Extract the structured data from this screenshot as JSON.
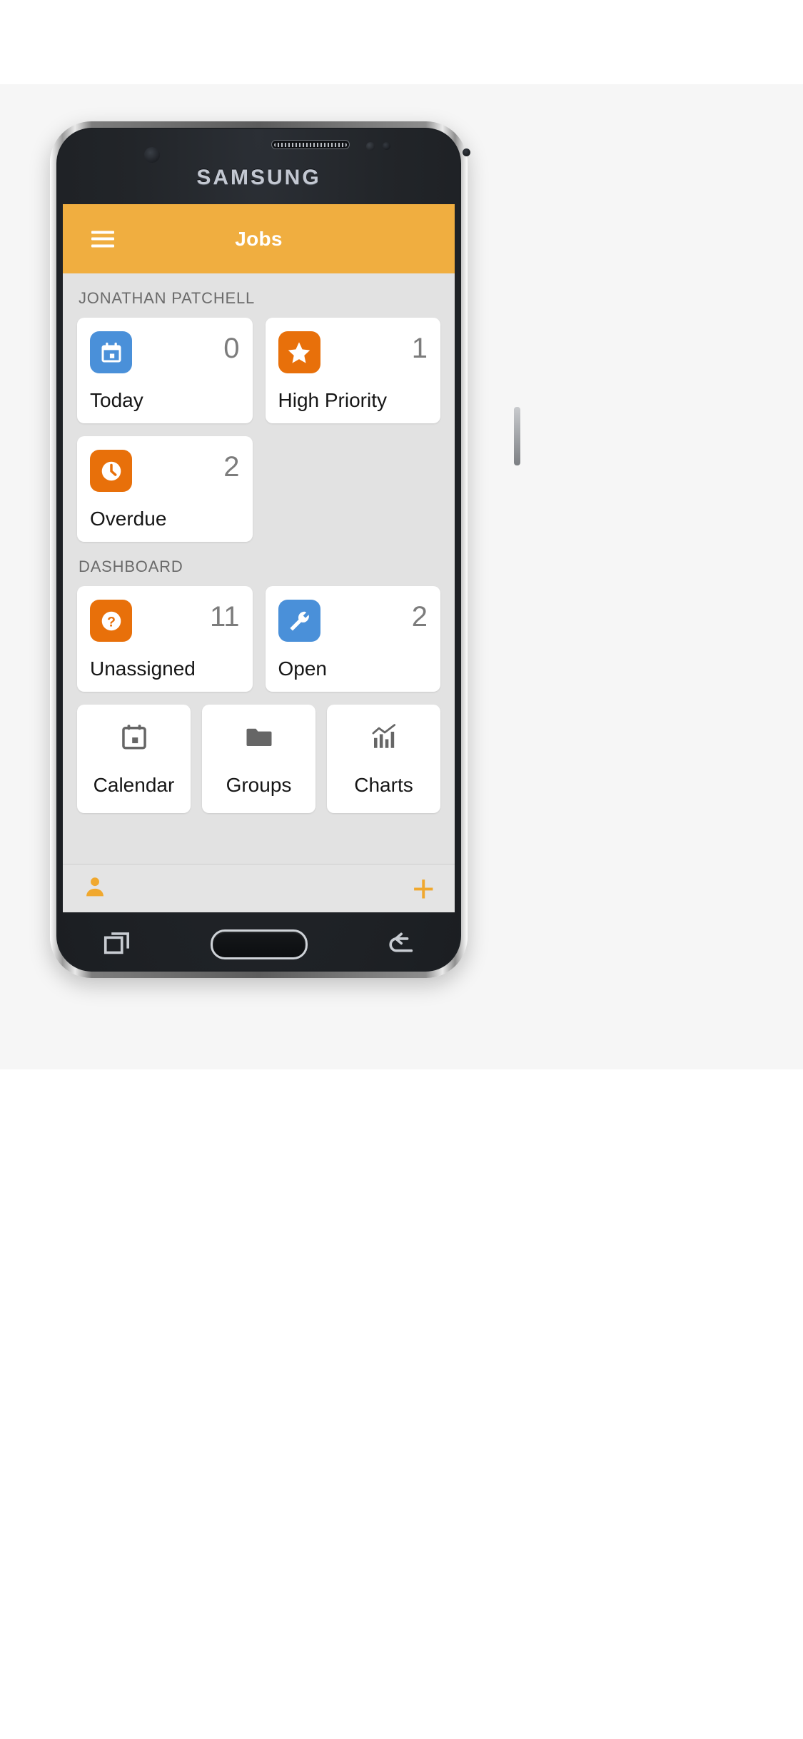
{
  "device": {
    "brand": "SAMSUNG"
  },
  "appbar": {
    "title": "Jobs",
    "menu_icon": "hamburger-menu-icon",
    "background_color": "#f0ae40",
    "title_color": "#ffffff"
  },
  "sections": [
    {
      "title": "JONATHAN PATCHELL",
      "cards": [
        {
          "label": "Today",
          "count": "0",
          "icon": "calendar-icon",
          "icon_color": "#4a90d9"
        },
        {
          "label": "High Priority",
          "count": "1",
          "icon": "star-icon",
          "icon_color": "#e8700a"
        },
        {
          "label": "Overdue",
          "count": "2",
          "icon": "clock-icon",
          "icon_color": "#e8700a"
        }
      ]
    },
    {
      "title": "DASHBOARD",
      "cards": [
        {
          "label": "Unassigned",
          "count": "11",
          "icon": "question-mark-icon",
          "icon_color": "#e8700a"
        },
        {
          "label": "Open",
          "count": "2",
          "icon": "wrench-icon",
          "icon_color": "#4a90d9"
        }
      ],
      "tiles": [
        {
          "label": "Calendar",
          "icon": "calendar-outline-icon",
          "icon_color": "#666666"
        },
        {
          "label": "Groups",
          "icon": "folder-icon",
          "icon_color": "#666666"
        },
        {
          "label": "Charts",
          "icon": "bar-chart-icon",
          "icon_color": "#666666"
        }
      ]
    }
  ],
  "bottombar": {
    "person_icon": "person-icon",
    "add_label": "+",
    "accent_color": "#f0a82e"
  },
  "navbar": {
    "recents_icon": "recent-apps-icon",
    "home_icon": "home-button",
    "back_icon": "back-icon"
  }
}
